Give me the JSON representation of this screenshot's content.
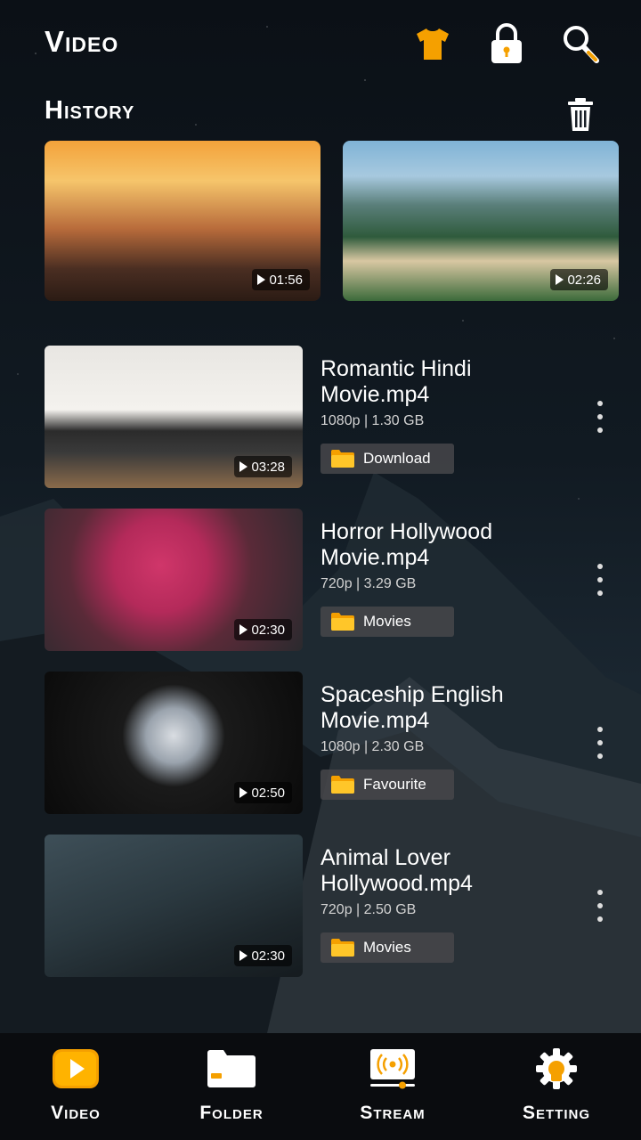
{
  "header": {
    "title": "Video",
    "icons": [
      "tshirt-icon",
      "lock-icon",
      "search-icon"
    ]
  },
  "history": {
    "title": "History",
    "items": [
      {
        "duration": "01:56"
      },
      {
        "duration": "02:26"
      }
    ]
  },
  "videos": [
    {
      "title": "Romantic Hindi Movie.mp4",
      "resolution": "1080p",
      "size": "1.30 GB",
      "meta": "1080p  |  1.30 GB",
      "folder": "Download",
      "duration": "03:28"
    },
    {
      "title": "Horror Hollywood Movie.mp4",
      "resolution": "720p",
      "size": "3.29 GB",
      "meta": "720p  |  3.29 GB",
      "folder": "Movies",
      "duration": "02:30"
    },
    {
      "title": "Spaceship English Movie.mp4",
      "resolution": "1080p",
      "size": "2.30 GB",
      "meta": "1080p  |  2.30 GB",
      "folder": "Favourite",
      "duration": "02:50"
    },
    {
      "title": "Animal Lover Hollywood.mp4",
      "resolution": "720p",
      "size": "2.50 GB",
      "meta": "720p  |  2.50 GB",
      "folder": "Movies",
      "duration": "02:30"
    }
  ],
  "nav": {
    "items": [
      {
        "label": "Video",
        "icon": "video-play-icon",
        "active": true
      },
      {
        "label": "Folder",
        "icon": "folder-icon"
      },
      {
        "label": "Stream",
        "icon": "stream-icon"
      },
      {
        "label": "Setting",
        "icon": "gear-icon"
      }
    ]
  },
  "colors": {
    "accent": "#f5a000",
    "accent_light": "#ffc629",
    "background": "#06080b",
    "chip": "#46464a"
  }
}
